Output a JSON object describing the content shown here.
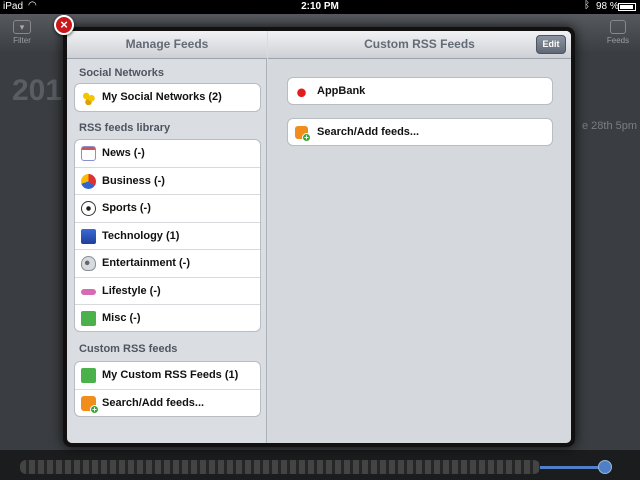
{
  "status_bar": {
    "carrier": "iPad",
    "time": "2:10 PM",
    "battery": "98 %"
  },
  "background_app": {
    "filter_label": "Filter",
    "feeds_label": "Feeds",
    "year_partial": "201",
    "date_partial": "e 28th 5pm"
  },
  "left_pane": {
    "title": "Manage Feeds",
    "sections": [
      {
        "header": "Social Networks",
        "items": [
          {
            "label": "My Social Networks (2)",
            "icon": "friends-icon"
          }
        ]
      },
      {
        "header": "RSS feeds library",
        "items": [
          {
            "label": "News (-)",
            "icon": "news-icon"
          },
          {
            "label": "Business (-)",
            "icon": "business-icon"
          },
          {
            "label": "Sports (-)",
            "icon": "sports-icon"
          },
          {
            "label": "Technology (1)",
            "icon": "technology-icon"
          },
          {
            "label": "Entertainment (-)",
            "icon": "entertainment-icon"
          },
          {
            "label": "Lifestyle (-)",
            "icon": "lifestyle-icon"
          },
          {
            "label": "Misc (-)",
            "icon": "misc-icon"
          }
        ]
      },
      {
        "header": "Custom RSS feeds",
        "items": [
          {
            "label": "My Custom RSS Feeds (1)",
            "icon": "custom-feeds-icon"
          },
          {
            "label": "Search/Add feeds...",
            "icon": "rss-add-icon"
          }
        ]
      }
    ]
  },
  "right_pane": {
    "title": "Custom RSS Feeds",
    "edit_label": "Edit",
    "feeds": [
      {
        "label": "AppBank",
        "icon": "apple-icon"
      },
      {
        "label": "Search/Add feeds...",
        "icon": "rss-add-icon"
      }
    ]
  },
  "colors": {
    "close_button": "#c9181b",
    "rss_orange": "#f18d1a",
    "accent_blue": "#4f7fc8"
  }
}
